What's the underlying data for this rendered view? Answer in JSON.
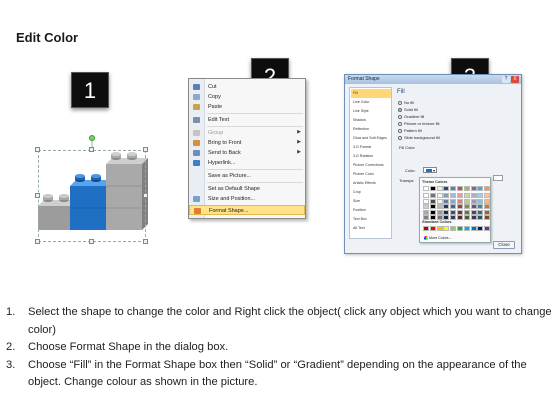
{
  "title": "Edit Color",
  "steps": [
    "1",
    "2",
    "3"
  ],
  "context_menu": {
    "items": [
      {
        "label": "Cut",
        "icon": "scissors-icon",
        "disabled": false,
        "submenu": false
      },
      {
        "label": "Copy",
        "icon": "copy-icon",
        "disabled": false,
        "submenu": false
      },
      {
        "label": "Paste",
        "icon": "paste-icon",
        "disabled": false,
        "submenu": false
      },
      {
        "label": "Edit Text",
        "icon": "edit-text-icon",
        "disabled": false,
        "submenu": false
      },
      {
        "label": "Group",
        "icon": "group-icon",
        "disabled": true,
        "submenu": true
      },
      {
        "label": "Bring to Front",
        "icon": "bring-front-icon",
        "disabled": false,
        "submenu": true
      },
      {
        "label": "Send to Back",
        "icon": "send-back-icon",
        "disabled": false,
        "submenu": true
      },
      {
        "label": "Hyperlink...",
        "icon": "hyperlink-icon",
        "disabled": false,
        "submenu": false
      },
      {
        "label": "Save as Picture...",
        "icon": "",
        "disabled": false,
        "submenu": false
      },
      {
        "label": "Set as Default Shape",
        "icon": "",
        "disabled": false,
        "submenu": false
      },
      {
        "label": "Size and Position...",
        "icon": "size-position-icon",
        "disabled": false,
        "submenu": false
      },
      {
        "label": "Format Shape...",
        "icon": "format-shape-icon",
        "disabled": false,
        "submenu": false
      }
    ]
  },
  "format_dialog": {
    "title": "Format Shape",
    "help": "?",
    "close": "X",
    "nav": [
      "Fill",
      "Line Color",
      "Line Style",
      "Shadow",
      "Reflection",
      "Glow and Soft Edges",
      "3-D Format",
      "3-D Rotation",
      "Picture Corrections",
      "Picture Color",
      "Artistic Effects",
      "Crop",
      "Size",
      "Position",
      "Text Box",
      "Alt Text"
    ],
    "fill_heading": "Fill",
    "options": [
      "No fill",
      "Solid fill",
      "Gradient fill",
      "Picture or texture fill",
      "Pattern fill",
      "Slide background fill"
    ],
    "selected_option": "Solid fill",
    "fill_color_label": "Fill Color",
    "color_label": "Color:",
    "transparency_label": "Transpa",
    "theme_colors_label": "Theme Colors",
    "standard_colors_label": "Standard Colors",
    "more_colors_label": "More Colors...",
    "close_button": "Close"
  },
  "instructions": [
    {
      "num": "1.",
      "text": "Select the shape to change the color and Right click the object( click any object which you want to change color)"
    },
    {
      "num": "2.",
      "text": "Choose Format Shape in the dialog box."
    },
    {
      "num": "3.",
      "text": "Choose “Fill” in the Format Shape box then “Solid” or “Gradient” depending on the appearance of the object. Change colour as shown in the picture."
    }
  ],
  "colors": {
    "badge_bg": "#0d0d0d",
    "brick_gray": "#a9a9a9",
    "brick_blue": "#1f6fc4",
    "highlight": "#ffe28a",
    "nav_selected": "#ffd777"
  }
}
